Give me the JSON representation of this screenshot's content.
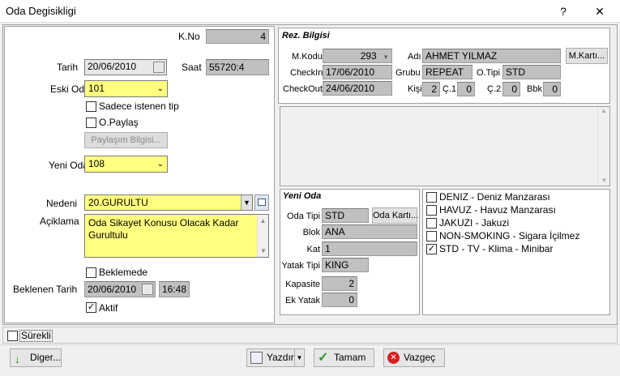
{
  "window": {
    "title": "Oda Degisikligi",
    "help": "?",
    "close": "✕"
  },
  "left": {
    "kno_label": "K.No",
    "kno_value": "4",
    "tarih_label": "Tarih",
    "tarih_value": "20/06/2010",
    "saat_label": "Saat",
    "saat_value": "55720:4",
    "eski_oda_label": "Eski Oda",
    "eski_oda_value": "101",
    "sadece_label": "Sadece istenen tip",
    "opaylas_label": "O.Paylaş",
    "paylasim_button": "Paylaşım Bilgisi...",
    "yeni_oda_label": "Yeni Oda",
    "yeni_oda_value": "108",
    "nedeni_label": "Nedeni",
    "nedeni_value": "20.GURULTU",
    "aciklama_label": "Açiklama",
    "aciklama_value": "Oda Sikayet Konusu Olacak Kadar Gurultulu",
    "beklemede_label": "Beklemede",
    "beklenen_label": "Beklenen Tarih",
    "beklenen_date": "20/06/2010",
    "beklenen_time": "16:48",
    "aktif_label": "Aktif"
  },
  "rez": {
    "header": "Rez. Bilgisi",
    "mkodu_label": "M.Kodu",
    "mkodu_value": "293",
    "adi_label": "Adı",
    "adi_value": "AHMET YILMAZ",
    "mkarti_button": "M.Kartı...",
    "checkin_label": "CheckIn",
    "checkin_value": "17/06/2010",
    "grubu_label": "Grubu",
    "grubu_value": "REPEAT",
    "otipi_label": "O.Tipi",
    "otipi_value": "STD",
    "checkout_label": "CheckOut",
    "checkout_value": "24/06/2010",
    "kisi_label": "Kişi",
    "kisi_value": "2",
    "c1_label": "Ç.1",
    "c1_value": "0",
    "c2_label": "Ç.2",
    "c2_value": "0",
    "bbk_label": "Bbk",
    "bbk_value": "0"
  },
  "yeni": {
    "header": "Yeni Oda",
    "odatipi_label": "Oda Tipi",
    "odatipi_value": "STD",
    "odakarti_button": "Oda Kartı...",
    "blok_label": "Blok",
    "blok_value": "ANA",
    "kat_label": "Kat",
    "kat_value": "1",
    "yatak_label": "Yatak Tipi",
    "yatak_value": "KING",
    "kapasite_label": "Kapasite",
    "kapasite_value": "2",
    "ekyatak_label": "Ek Yatak",
    "ekyatak_value": "0"
  },
  "features": [
    {
      "label": "DENIZ - Deniz Manzarası",
      "checked": false
    },
    {
      "label": "HAVUZ - Havuz Manzarası",
      "checked": false
    },
    {
      "label": "JAKUZI - Jakuzi",
      "checked": false
    },
    {
      "label": "NON-SMOKING - Sigara İçilmez",
      "checked": false
    },
    {
      "label": "STD - TV - Klima - Minibar",
      "checked": true
    }
  ],
  "footer": {
    "surekli_label": "Sürekli",
    "diger_button": "Diger...",
    "yazdir_button": "Yazdır",
    "tamam_button": "Tamam",
    "vazgec_button": "Vazgeç"
  },
  "icons": {
    "check": "✓",
    "chevron": "⌄",
    "arrow_down": "🡇"
  },
  "colors": {
    "yellow_field": "#ffff80",
    "readonly": "#c0c0c0"
  }
}
